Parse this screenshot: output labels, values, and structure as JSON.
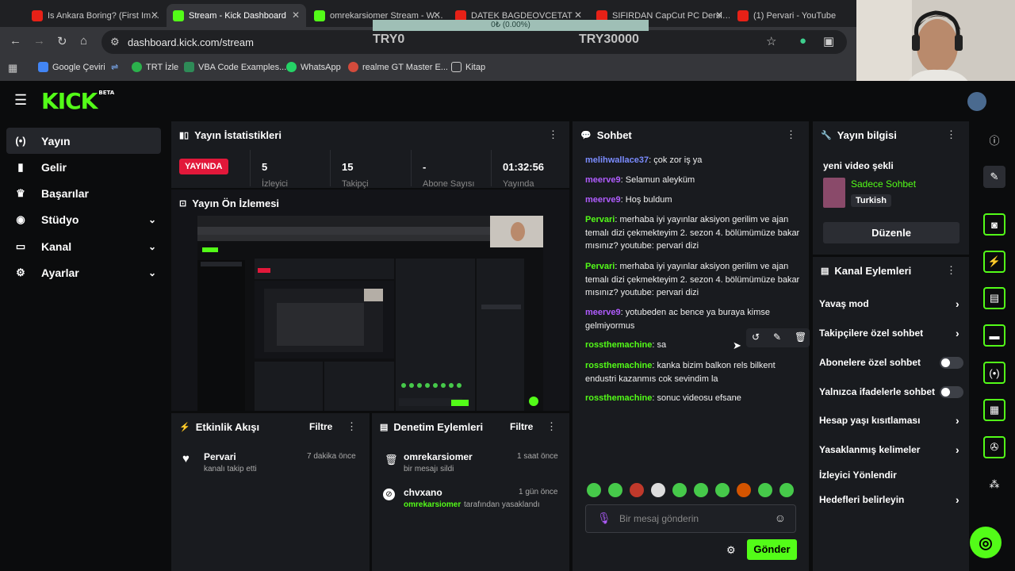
{
  "browser": {
    "tabs": [
      {
        "title": "Is Ankara Boring? (First Im…",
        "favicon": "youtube-icon"
      },
      {
        "title": "Stream - Kick Dashboard",
        "favicon": "kick-icon"
      },
      {
        "title": "omrekarsiomer Stream - W…",
        "favicon": "kick-icon"
      },
      {
        "title": "DATEK BAGDEOVCETAT",
        "favicon": "youtube-icon"
      },
      {
        "title": "SIFIRDAN CapCut PC Dersl…",
        "favicon": "youtube-icon"
      },
      {
        "title": "(1) Pervari - YouTube",
        "favicon": "youtube-icon"
      }
    ],
    "progress_label": "0₺ (0.00%)",
    "url": "dashboard.kick.com/stream",
    "overlay_left": "TRY0",
    "overlay_right": "TRY30000",
    "bookmarks": [
      "Google Çeviri",
      "TRT İzle",
      "VBA Code Examples...",
      "WhatsApp",
      "realme GT Master E...",
      "Kitap"
    ]
  },
  "kick": {
    "logo": "KICK",
    "logo_badge": "BETA",
    "nav": [
      {
        "label": "Yayın",
        "icon": "broadcast-icon",
        "active": true
      },
      {
        "label": "Gelir",
        "icon": "chart-icon"
      },
      {
        "label": "Başarılar",
        "icon": "trophy-icon"
      },
      {
        "label": "Stüdyo",
        "icon": "studio-icon",
        "expand": true
      },
      {
        "label": "Kanal",
        "icon": "channel-icon",
        "expand": true
      },
      {
        "label": "Ayarlar",
        "icon": "settings-icon",
        "expand": true
      }
    ]
  },
  "stats": {
    "title": "Yayın İstatistikleri",
    "live": "YAYINDA",
    "items": [
      {
        "value": "5",
        "label": "İzleyici"
      },
      {
        "value": "15",
        "label": "Takipçi"
      },
      {
        "value": "-",
        "label": "Abone Sayısı"
      },
      {
        "value": "01:32:56",
        "label": "Yayında"
      }
    ]
  },
  "preview": {
    "title": "Yayın Ön İzlemesi"
  },
  "activity": {
    "title": "Etkinlik Akışı",
    "filter": "Filtre",
    "items": [
      {
        "user": "Pervari",
        "text": "kanalı takip etti",
        "time": "7 dakika önce"
      }
    ]
  },
  "moderation": {
    "title": "Denetim Eylemleri",
    "filter": "Filtre",
    "items": [
      {
        "user": "omrekarsiomer",
        "text": "bir mesajı sildi",
        "time": "1 saat önce"
      },
      {
        "user": "chvxano",
        "actor": "omrekarsiomer",
        "text": "tarafından yasaklandı",
        "time": "1 gün önce"
      }
    ]
  },
  "chat": {
    "title": "Sohbet",
    "messages": [
      {
        "user": "melihwallace37",
        "color": "#7b8cff",
        "text": "çok zor iş ya"
      },
      {
        "user": "meerve9",
        "color": "#b05cff",
        "text": "Selamun aleyküm"
      },
      {
        "user": "meerve9",
        "color": "#b05cff",
        "text": "Hoş buldum"
      },
      {
        "user": "Pervari",
        "color": "#53fc18",
        "text": "merhaba iyi yayınlar aksiyon gerilim ve ajan temalı dizi çekmekteyim 2. sezon 4. bölümümüze bakar mısınız? youtube: pervari dizi"
      },
      {
        "user": "Pervari",
        "color": "#53fc18",
        "text": "merhaba iyi yayınlar aksiyon gerilim ve ajan temalı dizi çekmekteyim 2. sezon 4. bölümümüze bakar mısınız? youtube: pervari dizi"
      },
      {
        "user": "meerve9",
        "color": "#b05cff",
        "text": "yotubeden ac bence ya buraya kimse gelmiyormus"
      },
      {
        "user": "rossthemachine",
        "color": "#53fc18",
        "text": "sa"
      },
      {
        "user": "rossthemachine",
        "color": "#53fc18",
        "text": "kanka bizim balkon rels bilkent endustri kazanmıs cok sevindim la"
      },
      {
        "user": "rossthemachine",
        "color": "#53fc18",
        "text": "sonuc videosu efsane"
      }
    ],
    "placeholder": "Bir mesaj gönderin",
    "send": "Gönder"
  },
  "info": {
    "title": "Yayın bilgisi",
    "stream_title": "yeni video şekli",
    "category": "Sadece Sohbet",
    "language": "Turkish",
    "edit": "Düzenle"
  },
  "channel_actions": {
    "title": "Kanal Eylemleri",
    "rows": [
      {
        "label": "Yavaş mod",
        "type": "arrow"
      },
      {
        "label": "Takipçilere özel sohbet",
        "type": "arrow"
      },
      {
        "label": "Abonelere özel sohbet",
        "type": "toggle"
      },
      {
        "label": "Yalnızca ifadelerle sohbet",
        "type": "toggle"
      },
      {
        "label": "Hesap yaşı kısıtlaması",
        "type": "arrow"
      },
      {
        "label": "Yasaklanmış kelimeler",
        "type": "arrow"
      },
      {
        "label": "İzleyici Yönlendir",
        "type": "none"
      },
      {
        "label": "Hedefleri belirleyin",
        "type": "arrow"
      }
    ]
  },
  "colors": {
    "accent": "#53fc18",
    "live": "#e2183a",
    "panel": "#191b1f"
  }
}
